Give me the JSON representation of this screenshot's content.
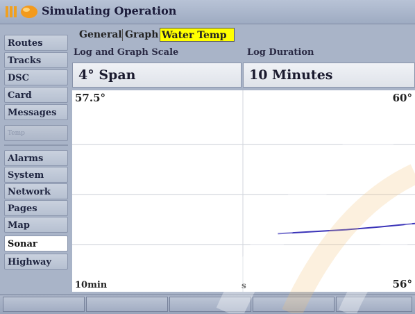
{
  "window": {
    "title": "Simulating Operation",
    "icon": "garmin-flag-icon"
  },
  "sidebar": {
    "items": [
      {
        "label": "Routes",
        "selected": false
      },
      {
        "label": "Tracks",
        "selected": false
      },
      {
        "label": "DSC",
        "selected": false
      },
      {
        "label": "Card",
        "selected": false
      },
      {
        "label": "Messages",
        "selected": false
      },
      {
        "label": "Temp",
        "selected": false,
        "disabled": true
      },
      {
        "label": "Alarms",
        "selected": false
      },
      {
        "label": "System",
        "selected": false
      },
      {
        "label": "Network",
        "selected": false
      },
      {
        "label": "Pages",
        "selected": false
      },
      {
        "label": "Map",
        "selected": false
      },
      {
        "label": "Sonar",
        "selected": true
      },
      {
        "label": "Highway",
        "selected": false
      }
    ]
  },
  "tabs": [
    {
      "label": "General",
      "active": false
    },
    {
      "label": "Graph",
      "active": false
    },
    {
      "label": "Water Temp",
      "active": true
    }
  ],
  "settings": {
    "scale_header": "Log and Graph Scale",
    "scale_value": "4° Span",
    "duration_header": "Log Duration",
    "duration_value": "10 Minutes"
  },
  "graph": {
    "current_temp": "57.5°",
    "y_max_label": "60°",
    "y_min_label": "56°",
    "x_left_label": "10min",
    "x_mid_label": "s",
    "y_min": 56,
    "y_max": 60,
    "line_color": "#3a33b8",
    "series": [
      {
        "t": 0.6,
        "temp": 56.95
      },
      {
        "t": 0.7,
        "temp": 57.0
      },
      {
        "t": 0.8,
        "temp": 57.05
      },
      {
        "t": 0.9,
        "temp": 57.12
      },
      {
        "t": 1.0,
        "temp": 57.2
      }
    ]
  },
  "colors": {
    "accent": "#ffff00",
    "background": "#a9b4c8"
  }
}
